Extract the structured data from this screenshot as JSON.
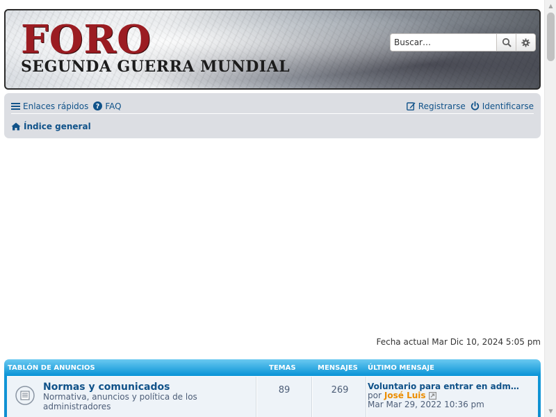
{
  "header": {
    "logo_title": "FORO",
    "logo_subtitle": "SEGUNDA GUERRA MUNDIAL",
    "search": {
      "placeholder": "Buscar…"
    }
  },
  "navbar": {
    "quick_links_label": "Enlaces rápidos",
    "faq_label": "FAQ",
    "register_label": "Registrarse",
    "login_label": "Identificarse",
    "breadcrumb_home": "Índice general"
  },
  "current_date": "Fecha actual Mar Dic 10, 2024 5:05 pm",
  "forum_list": {
    "headers": {
      "forum": "TABLÓN DE ANUNCIOS",
      "topics": "TEMAS",
      "posts": "MENSAJES",
      "last_post": "ÚLTIMO MENSAJE"
    },
    "rows": [
      {
        "title": "Normas y comunicados",
        "description": "Normativa, anuncios y política de los administradores",
        "topics": "89",
        "posts": "269",
        "last_post_title": "Voluntario para entrar en adm…",
        "last_post_by_prefix": "por",
        "last_post_user": "José Luis",
        "last_post_date": "Mar Mar 29, 2022 10:36 pm"
      }
    ]
  },
  "colors": {
    "link": "#105289",
    "username": "#ec8d00",
    "logo_red": "#9b1c22",
    "forum_header": "#1097d8"
  }
}
